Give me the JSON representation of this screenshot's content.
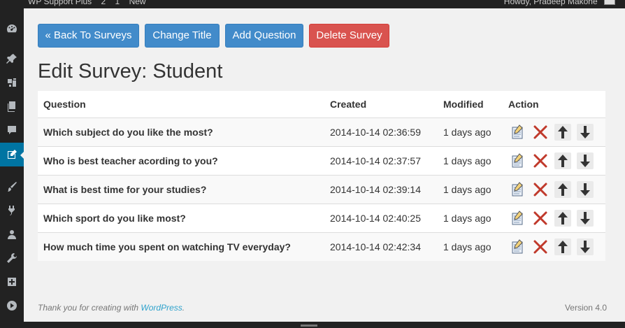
{
  "adminbar": {
    "site_name": "WP Support Plus",
    "comments_count": "2",
    "updates_count": "1",
    "new_label": "New",
    "howdy": "Howdy, Pradeep Makone"
  },
  "sidebar": {
    "items": [
      {
        "name": "dashboard-icon",
        "active": false
      },
      {
        "name": "posts-pin-icon",
        "active": false
      },
      {
        "name": "media-icon",
        "active": false
      },
      {
        "name": "pages-icon",
        "active": false
      },
      {
        "name": "comments-icon",
        "active": false
      },
      {
        "name": "survey-edit-icon",
        "active": true
      },
      {
        "name": "appearance-brush-icon",
        "active": false
      },
      {
        "name": "plugins-icon",
        "active": false
      },
      {
        "name": "users-icon",
        "active": false
      },
      {
        "name": "tools-wrench-icon",
        "active": false
      },
      {
        "name": "settings-icon",
        "active": false
      },
      {
        "name": "collapse-play-icon",
        "active": false
      }
    ]
  },
  "toolbar": {
    "back_label": "« Back To Surveys",
    "change_title_label": "Change Title",
    "add_question_label": "Add Question",
    "delete_label": "Delete Survey"
  },
  "page_title": "Edit Survey: Student",
  "table": {
    "headers": {
      "question": "Question",
      "created": "Created",
      "modified": "Modified",
      "action": "Action"
    },
    "rows": [
      {
        "question": "Which subject do you like the most?",
        "created": "2014-10-14 02:36:59",
        "modified": "1 days ago"
      },
      {
        "question": "Who is best teacher acording to you?",
        "created": "2014-10-14 02:37:57",
        "modified": "1 days ago"
      },
      {
        "question": "What is best time for your studies?",
        "created": "2014-10-14 02:39:14",
        "modified": "1 days ago"
      },
      {
        "question": "Which sport do you like most?",
        "created": "2014-10-14 02:40:25",
        "modified": "1 days ago"
      },
      {
        "question": "How much time you spent on watching TV everyday?",
        "created": "2014-10-14 02:42:34",
        "modified": "1 days ago"
      }
    ]
  },
  "footer": {
    "thanks_prefix": "Thank you for creating with ",
    "wordpress_link": "WordPress",
    "thanks_suffix": ".",
    "version": "Version 4.0"
  },
  "colors": {
    "primary_button": "#428bca",
    "danger_button": "#d9534f",
    "active_menu": "#0074a2",
    "delete_x": "#c0392b"
  }
}
